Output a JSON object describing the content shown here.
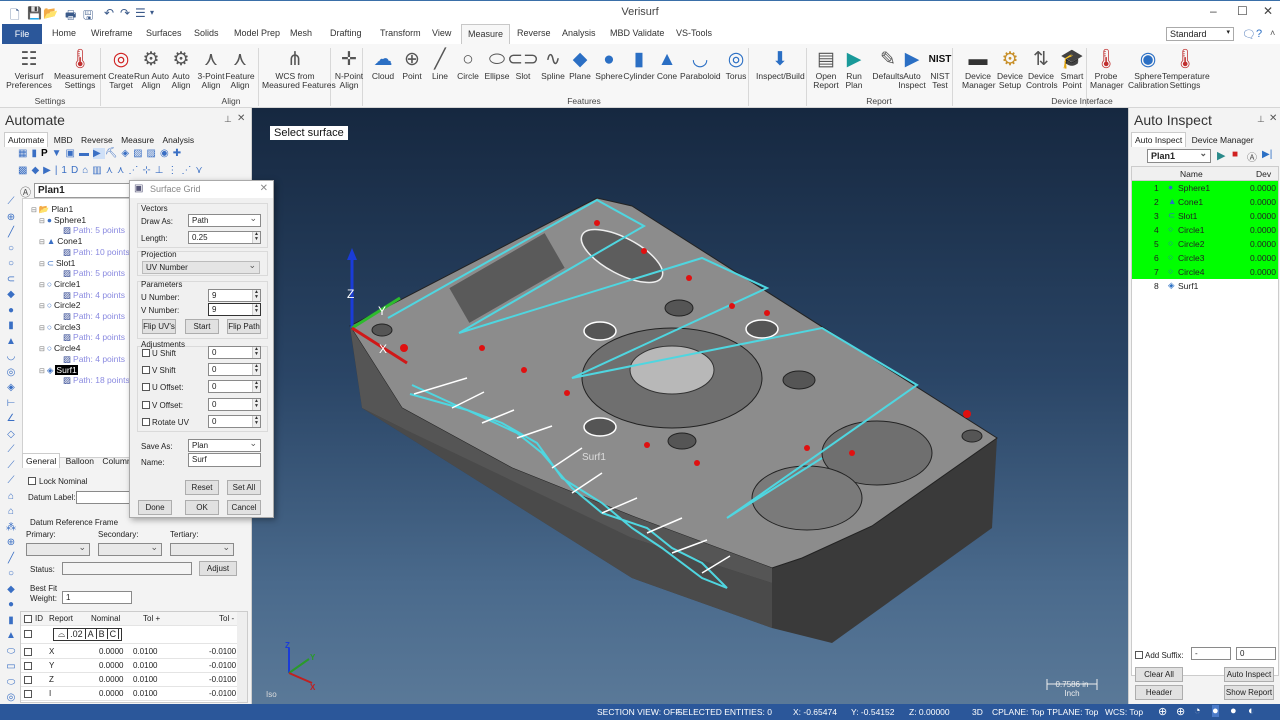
{
  "app": {
    "title": "Verisurf"
  },
  "quick_access": [
    "new-icon",
    "save-icon",
    "open-icon",
    "print-icon",
    "save-as-icon",
    "undo-icon",
    "redo-icon",
    "customize-icon"
  ],
  "ribbon_tabs": [
    "File",
    "Home",
    "Wireframe",
    "Surfaces",
    "Solids",
    "Model Prep",
    "Mesh",
    "Drafting",
    "Transform",
    "View",
    "Measure",
    "Reverse",
    "Analysis",
    "MBD Validate",
    "VS-Tools"
  ],
  "active_tab": "Measure",
  "workspace_select": "Standard",
  "ribbon": {
    "groups": [
      {
        "name": "Settings",
        "buttons": [
          {
            "label": "Verisurf\nPreferences",
            "icon": "preferences-icon"
          },
          {
            "label": "Measurement\nSettings",
            "icon": "thermometer-gear-icon"
          }
        ]
      },
      {
        "name": "Align",
        "buttons": [
          {
            "label": "Create\nTarget",
            "icon": "target-icon"
          },
          {
            "label": "Run Auto\nAlign",
            "icon": "run-align-icon"
          },
          {
            "label": "Auto\nAlign",
            "icon": "auto-align-icon"
          },
          {
            "label": "3-Point\nAlign",
            "icon": "three-point-align-icon"
          },
          {
            "label": "Feature\nAlign",
            "icon": "feature-align-icon"
          },
          {
            "label": "WCS from\nMeasured Features",
            "icon": "wcs-icon"
          },
          {
            "label": "N-Point\nAlign",
            "icon": "n-point-align-icon"
          }
        ]
      },
      {
        "name": "Features",
        "buttons": [
          {
            "label": "Cloud",
            "icon": "cloud-icon"
          },
          {
            "label": "Point",
            "icon": "point-icon"
          },
          {
            "label": "Line",
            "icon": "line-icon"
          },
          {
            "label": "Circle",
            "icon": "circle-icon"
          },
          {
            "label": "Ellipse",
            "icon": "ellipse-icon"
          },
          {
            "label": "Slot",
            "icon": "slot-icon"
          },
          {
            "label": "Spline",
            "icon": "spline-icon"
          },
          {
            "label": "Plane",
            "icon": "plane-icon"
          },
          {
            "label": "Sphere",
            "icon": "sphere-icon"
          },
          {
            "label": "Cylinder",
            "icon": "cylinder-icon"
          },
          {
            "label": "Cone",
            "icon": "cone-icon"
          },
          {
            "label": "Paraboloid",
            "icon": "paraboloid-icon"
          },
          {
            "label": "Torus",
            "icon": "torus-icon"
          },
          {
            "label": "Inspect/Build",
            "icon": "inspect-build-icon"
          }
        ]
      },
      {
        "name": "Report",
        "buttons": [
          {
            "label": "Open\nReport",
            "icon": "open-report-icon"
          },
          {
            "label": "Run\nPlan",
            "icon": "run-plan-icon"
          },
          {
            "label": "Defaults",
            "icon": "defaults-icon"
          },
          {
            "label": "Auto\nInspect",
            "icon": "play-icon"
          },
          {
            "label": "NIST\nTest",
            "icon": "nist-icon"
          }
        ]
      },
      {
        "name": "Device Interface",
        "buttons": [
          {
            "label": "Device\nManager",
            "icon": "device-manager-icon"
          },
          {
            "label": "Device\nSetup",
            "icon": "gear-icon"
          },
          {
            "label": "Device\nControls",
            "icon": "device-controls-icon"
          },
          {
            "label": "Smart\nPoint",
            "icon": "smart-point-icon"
          },
          {
            "label": "Probe\nManager",
            "icon": "probe-manager-icon"
          },
          {
            "label": "Sphere\nCalibration",
            "icon": "sphere-calibration-icon"
          },
          {
            "label": "Temperature\nSettings",
            "icon": "temperature-icon"
          }
        ]
      }
    ]
  },
  "automate": {
    "title": "Automate",
    "tabs": [
      "Automate",
      "MBD",
      "Reverse",
      "Measure",
      "Analysis"
    ],
    "plan_name": "Plan1",
    "tree": [
      {
        "label": "Plan1",
        "level": 0
      },
      {
        "label": "Sphere1",
        "level": 1
      },
      {
        "label": "Path: 5 points",
        "level": 2
      },
      {
        "label": "Cone1",
        "level": 1
      },
      {
        "label": "Path: 10 points",
        "level": 2
      },
      {
        "label": "Slot1",
        "level": 1
      },
      {
        "label": "Path: 5 points",
        "level": 2
      },
      {
        "label": "Circle1",
        "level": 1
      },
      {
        "label": "Path: 4 points",
        "level": 2
      },
      {
        "label": "Circle2",
        "level": 1
      },
      {
        "label": "Path: 4 points",
        "level": 2
      },
      {
        "label": "Circle3",
        "level": 1
      },
      {
        "label": "Path: 4 points",
        "level": 2
      },
      {
        "label": "Circle4",
        "level": 1
      },
      {
        "label": "Path: 4 points",
        "level": 2
      },
      {
        "label": "Surf1",
        "level": 1,
        "selected": true
      },
      {
        "label": "Path: 18 points",
        "level": 2
      }
    ],
    "prop_tabs": [
      "General",
      "Balloon",
      "Columns"
    ],
    "lock_nominal": "Lock Nominal",
    "datum_label": "Datum Label:",
    "drf_title": "Datum Reference Frame",
    "primary": "Primary:",
    "secondary": "Secondary:",
    "tertiary": "Tertiary:",
    "status_label": "Status:",
    "adjust": "Adjust",
    "best_fit": "Best Fit",
    "weight_label": "Weight:",
    "weight_value": "1",
    "table": {
      "headers": [
        "ID",
        "Report",
        "Nominal",
        "Tol +",
        "Tol -"
      ],
      "fcf": [
        "⌓",
        ".02",
        "A",
        "B",
        "C"
      ],
      "rows": [
        [
          "X",
          "0.0000",
          "0.0100",
          "-0.0100"
        ],
        [
          "Y",
          "0.0000",
          "0.0100",
          "-0.0100"
        ],
        [
          "Z",
          "0.0000",
          "0.0100",
          "-0.0100"
        ],
        [
          "I",
          "0.0000",
          "0.0100",
          "-0.0100"
        ]
      ]
    }
  },
  "dialog": {
    "title": "Surface Grid",
    "vectors": "Vectors",
    "draw_as_label": "Draw As:",
    "draw_as": "Path",
    "length_label": "Length:",
    "length": "0.25",
    "projection": "Projection",
    "projection_value": "UV Number",
    "parameters": "Parameters",
    "u_label": "U Number:",
    "u_value": "9",
    "v_label": "V Number:",
    "v_value": "9",
    "flip_uvs": "Flip UV's",
    "start": "Start",
    "flip_path": "Flip Path",
    "adjustments": "Adjustments",
    "adj": [
      {
        "label": "U Shift",
        "value": "0"
      },
      {
        "label": "V Shift",
        "value": "0"
      },
      {
        "label": "U Offset:",
        "value": "0"
      },
      {
        "label": "V Offset:",
        "value": "0"
      },
      {
        "label": "Rotate UV",
        "value": "0"
      }
    ],
    "save_as_label": "Save As:",
    "save_as": "Plan",
    "name_label": "Name:",
    "name": "Surf",
    "reset": "Reset",
    "set_all": "Set All",
    "done": "Done",
    "ok": "OK",
    "cancel": "Cancel"
  },
  "viewport": {
    "prompt": "Select surface",
    "surf_label": "Surf1",
    "view_name": "Iso",
    "scale": "0.7586 in",
    "scale_unit": "Inch",
    "axis": {
      "x": "X",
      "y": "Y",
      "z": "Z"
    }
  },
  "auto_inspect": {
    "title": "Auto Inspect",
    "tabs": [
      "Auto Inspect",
      "Device Manager"
    ],
    "plan": "Plan1",
    "headers": [
      "Name",
      "Dev"
    ],
    "rows": [
      {
        "id": "1",
        "name": "Sphere1",
        "dev": "0.0000",
        "ok": true
      },
      {
        "id": "2",
        "name": "Cone1",
        "dev": "0.0000",
        "ok": true
      },
      {
        "id": "3",
        "name": "Slot1",
        "dev": "0.0000",
        "ok": true
      },
      {
        "id": "4",
        "name": "Circle1",
        "dev": "0.0000",
        "ok": true
      },
      {
        "id": "5",
        "name": "Circle2",
        "dev": "0.0000",
        "ok": true
      },
      {
        "id": "6",
        "name": "Circle3",
        "dev": "0.0000",
        "ok": true
      },
      {
        "id": "7",
        "name": "Circle4",
        "dev": "0.0000",
        "ok": true
      },
      {
        "id": "8",
        "name": "Surf1",
        "dev": "",
        "ok": false
      }
    ],
    "ok_color": "#00ff00",
    "add_suffix": "Add Suffix:",
    "suffix_sep": "-",
    "suffix_num": "0",
    "clear_all": "Clear All",
    "auto_inspect_btn": "Auto Inspect",
    "header": "Header",
    "show_report": "Show Report"
  },
  "status": {
    "section": "SECTION VIEW: OFF",
    "selected": "SELECTED ENTITIES: 0",
    "x": "X:  -0.65474",
    "y": "Y:  -0.54152",
    "z": "Z:  0.00000",
    "mode": "3D",
    "cplane": "CPLANE: Top",
    "tplane": "TPLANE: Top",
    "wcs": "WCS: Top"
  }
}
